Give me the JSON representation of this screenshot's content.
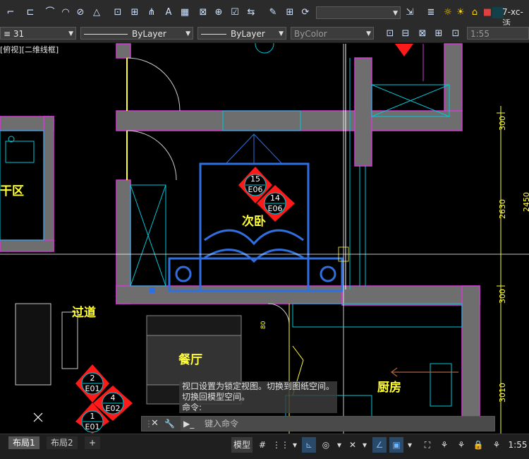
{
  "toolbar": {
    "layer_combo": "",
    "layer_name": "7-xc-活",
    "scale_prefix": "≡ 31"
  },
  "properties": {
    "color": "ByColor",
    "linetype": "ByLayer",
    "lineweight": "ByLayer",
    "scale": "1:55"
  },
  "viewport": {
    "label": "[俯视][二维线框]"
  },
  "drawing": {
    "rooms": [
      "干区",
      "次卧",
      "过道",
      "餐厅",
      "厨房"
    ],
    "tags": [
      {
        "num": "15",
        "code": "E06"
      },
      {
        "num": "14",
        "code": "E06"
      },
      {
        "num": "2",
        "code": "E01"
      },
      {
        "num": "4",
        "code": "E02"
      },
      {
        "num": "1",
        "code": "E01"
      }
    ],
    "dims": [
      "300",
      "2630",
      "300",
      "3010",
      "2450",
      "80"
    ]
  },
  "command": {
    "history": [
      "视口设置为锁定视图。切换到图纸空间。",
      "切换回模型空间。",
      "命令:"
    ],
    "placeholder": "键入命令"
  },
  "tabs": [
    "布局1",
    "布局2"
  ],
  "status": {
    "model": "模型",
    "scale": "1:55"
  },
  "colors": {
    "wall": "#6e6e6e",
    "outline": "#d13bd1",
    "furniture": "#2f6fe0",
    "cad_cyan": "#00c8d8",
    "label": "#ffff33",
    "tag_red": "#ff1a1a"
  }
}
